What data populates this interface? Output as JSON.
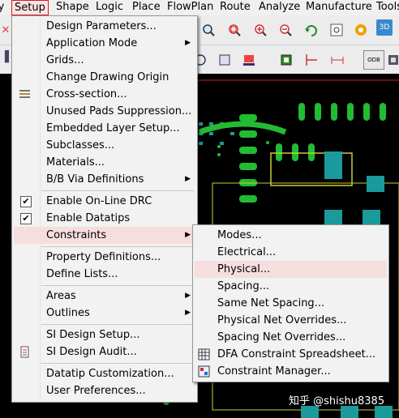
{
  "menubar": {
    "items": [
      "ly",
      "Setup",
      "Shape",
      "Logic",
      "Place",
      "FlowPlan",
      "Route",
      "Analyze",
      "Manufacture",
      "Tools"
    ]
  },
  "setup_menu": {
    "items": [
      {
        "label": "Design Parameters..."
      },
      {
        "label": "Application Mode",
        "submenu": true
      },
      {
        "label": "Grids..."
      },
      {
        "label": "Change Drawing Origin"
      },
      {
        "label": "Cross-section..."
      },
      {
        "label": "Unused Pads Suppression..."
      },
      {
        "label": "Embedded Layer Setup..."
      },
      {
        "label": "Subclasses..."
      },
      {
        "label": "Materials..."
      },
      {
        "label": "B/B Via Definitions",
        "submenu": true
      },
      {
        "label": "Enable On-Line DRC",
        "checked": true
      },
      {
        "label": "Enable Datatips",
        "checked": true
      },
      {
        "label": "Constraints",
        "submenu": true,
        "highlighted": true
      },
      {
        "label": "Property Definitions..."
      },
      {
        "label": "Define Lists..."
      },
      {
        "label": "Areas",
        "submenu": true
      },
      {
        "label": "Outlines",
        "submenu": true
      },
      {
        "label": "SI Design Setup..."
      },
      {
        "label": "SI Design Audit..."
      },
      {
        "label": "Datatip Customization..."
      },
      {
        "label": "User Preferences..."
      }
    ]
  },
  "constraints_submenu": {
    "items": [
      {
        "label": "Modes..."
      },
      {
        "label": "Electrical..."
      },
      {
        "label": "Physical...",
        "highlighted": true
      },
      {
        "label": "Spacing..."
      },
      {
        "label": "Same Net Spacing..."
      },
      {
        "label": "Physical Net Overrides..."
      },
      {
        "label": "Spacing Net Overrides..."
      },
      {
        "label": "DFA Constraint Spreadsheet..."
      },
      {
        "label": "Constraint Manager..."
      }
    ]
  },
  "toolbar": {
    "icon_3d": "3D",
    "icon_odb": "ODB"
  },
  "watermark": "知乎 @shishu8385",
  "colors": {
    "menu_bg": "#f2f2f2",
    "highlight": "#f6dede",
    "active_border": "#cc2222",
    "pcb_green": "#22bb33",
    "pcb_teal": "#1a9a9a",
    "pcb_yellow": "#cccc33"
  }
}
